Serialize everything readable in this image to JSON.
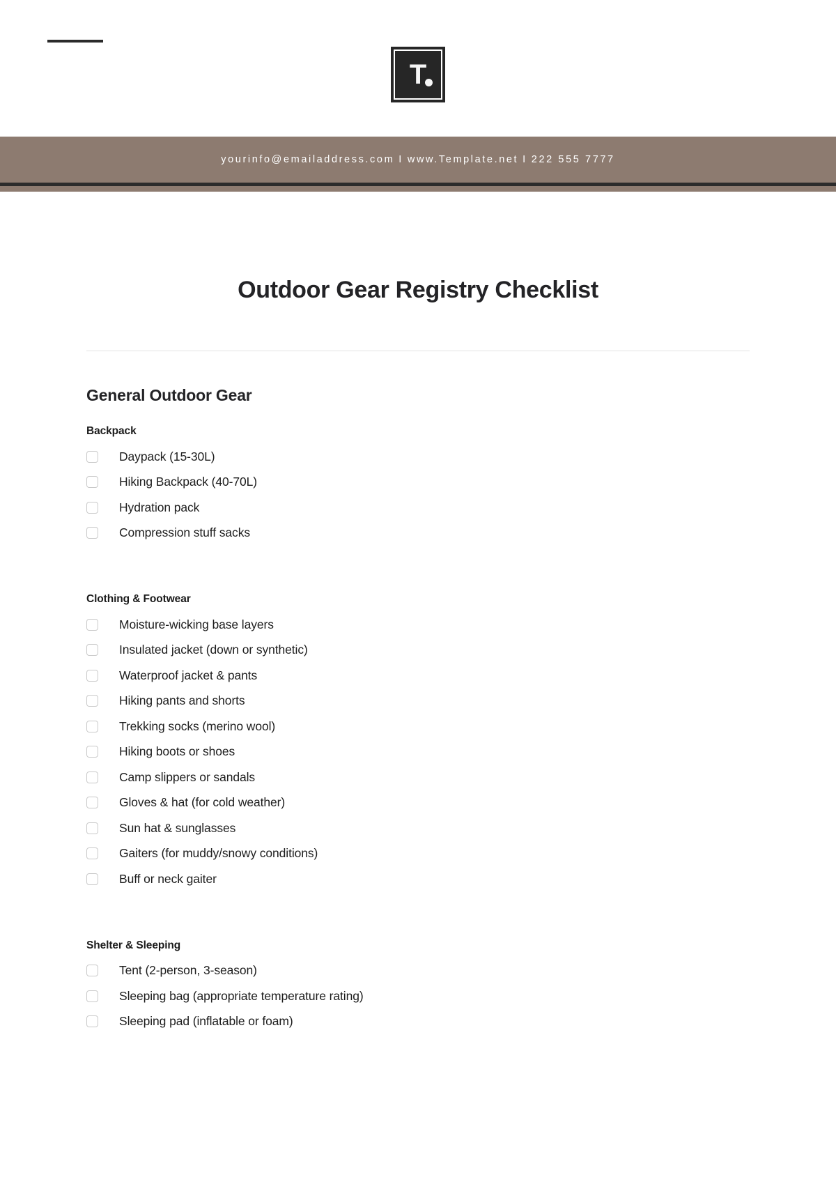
{
  "header": {
    "logo_letter": "T",
    "logo_dot": "●"
  },
  "contact": {
    "email": "yourinfo@emailaddress.com",
    "separator": "I",
    "website": "www.Template.net",
    "phone": "222 555 7777"
  },
  "document": {
    "title": "Outdoor Gear Registry Checklist",
    "section_title": "General Outdoor Gear"
  },
  "subsections": [
    {
      "title": "Backpack",
      "items": [
        "Daypack (15-30L)",
        "Hiking Backpack (40-70L)",
        "Hydration pack",
        "Compression stuff sacks"
      ]
    },
    {
      "title": "Clothing & Footwear",
      "items": [
        "Moisture-wicking base layers",
        "Insulated jacket (down or synthetic)",
        "Waterproof jacket & pants",
        "Hiking pants and shorts",
        "Trekking socks (merino wool)",
        "Hiking boots or shoes",
        "Camp slippers or sandals",
        "Gloves & hat (for cold weather)",
        "Sun hat & sunglasses",
        "Gaiters (for muddy/snowy conditions)",
        "Buff or neck gaiter"
      ]
    },
    {
      "title": "Shelter & Sleeping",
      "items": [
        "Tent (2-person, 3-season)",
        "Sleeping bag (appropriate temperature rating)",
        "Sleeping pad (inflatable or foam)"
      ]
    }
  ],
  "colors": {
    "contact_bar": "#8d7b70",
    "rule": "#2b2b2b",
    "logo": "#262626",
    "text": "#1e1e1e",
    "checkbox_border": "#c9c9c9"
  }
}
